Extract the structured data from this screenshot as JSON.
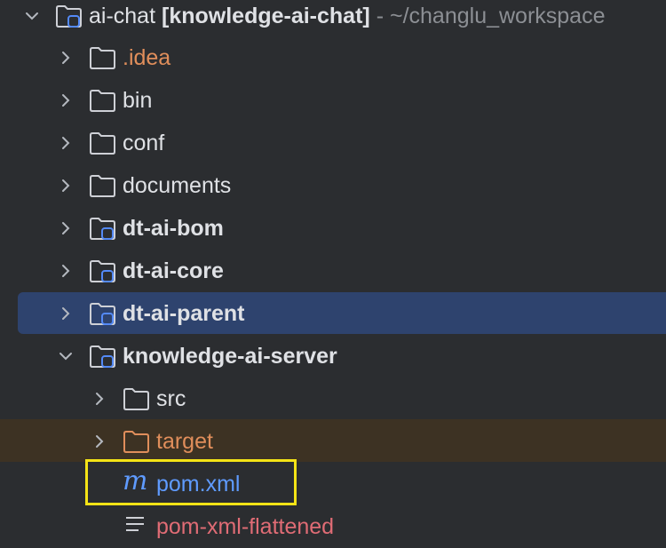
{
  "tree": {
    "root": {
      "name": "ai-chat",
      "module": "[knowledge-ai-chat]",
      "path": " - ~/changlu_workspace"
    },
    "items": [
      {
        "label": ".idea",
        "icon": "folder-icon",
        "color": "#e08e5b"
      },
      {
        "label": "bin",
        "icon": "folder-icon",
        "color": "#dfe1e5"
      },
      {
        "label": "conf",
        "icon": "folder-icon",
        "color": "#dfe1e5"
      },
      {
        "label": "documents",
        "icon": "folder-icon",
        "color": "#dfe1e5"
      },
      {
        "label": "dt-ai-bom",
        "icon": "module-folder-icon",
        "color": "#dfe1e5"
      },
      {
        "label": "dt-ai-core",
        "icon": "module-folder-icon",
        "color": "#dfe1e5"
      },
      {
        "label": "dt-ai-parent",
        "icon": "module-folder-icon",
        "color": "#dfe1e5"
      },
      {
        "label": "knowledge-ai-server",
        "icon": "module-folder-icon",
        "color": "#dfe1e5"
      },
      {
        "label": "src",
        "icon": "folder-icon",
        "color": "#dfe1e5"
      },
      {
        "label": "target",
        "icon": "excluded-folder-icon",
        "color": "#e08e5b"
      },
      {
        "label": "pom.xml",
        "icon": "maven-icon",
        "color": "#5f9bff"
      },
      {
        "label": "pom-xml-flattened",
        "icon": "file-text-icon",
        "color": "#e06c75"
      }
    ]
  }
}
